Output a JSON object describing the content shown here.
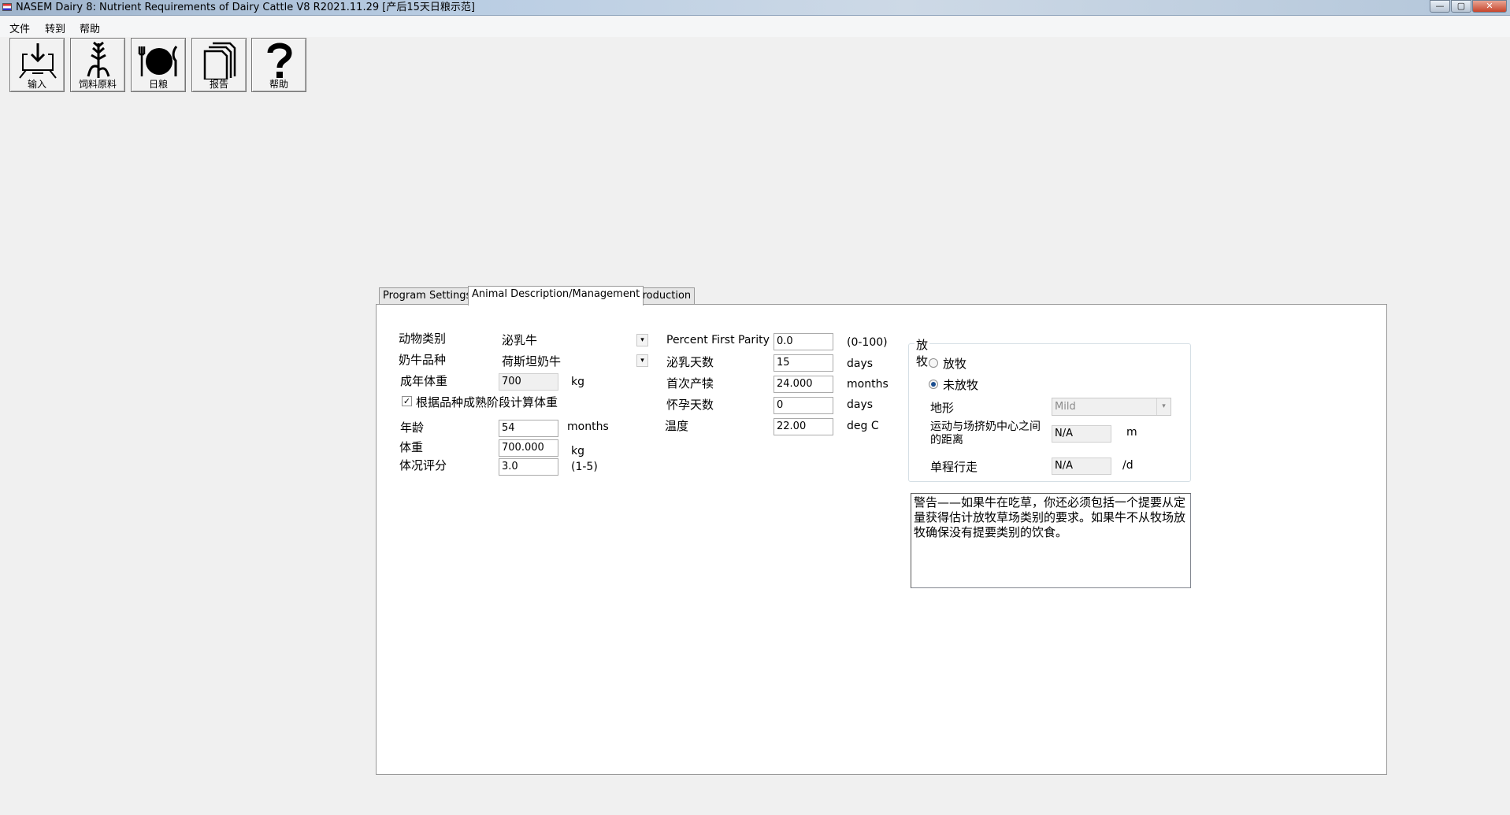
{
  "window": {
    "title": "NASEM Dairy 8: Nutrient Requirements of Dairy Cattle  V8 R2021.11.29 [产后15天日粮示范]"
  },
  "menu": {
    "items": [
      {
        "label": "文件"
      },
      {
        "label": "转到"
      },
      {
        "label": "帮助"
      }
    ]
  },
  "toolbar": {
    "buttons": [
      {
        "label": "输入",
        "icon": "input-icon"
      },
      {
        "label": "饲料原料",
        "icon": "feed-plant-icon"
      },
      {
        "label": "日粮",
        "icon": "plate-icon"
      },
      {
        "label": "报告",
        "icon": "report-icon"
      },
      {
        "label": "帮助",
        "icon": "help-icon"
      }
    ]
  },
  "tabs": [
    {
      "label": "Program Settings"
    },
    {
      "label": "Animal Description/Management",
      "active": true
    },
    {
      "label": "Production"
    }
  ],
  "animal": {
    "type_label": "动物类别",
    "type_value": "泌乳牛",
    "breed_label": "奶牛品种",
    "breed_value": "荷斯坦奶牛",
    "mature_bw_label": "成年体重",
    "mature_bw_value": "700",
    "mature_bw_unit": "kg",
    "calc_by_breed_label": "根据品种成熟阶段计算体重",
    "calc_by_breed_checked": true,
    "age_label": "年龄",
    "age_value": "54",
    "age_unit": "months",
    "bw_label": "体重",
    "bw_value": "700.000",
    "bw_unit": "kg",
    "bcs_label": "体况评分",
    "bcs_value": "3.0",
    "bcs_unit": "(1-5)"
  },
  "management": {
    "pfp_label": "Percent First Parity",
    "pfp_value": "0.0",
    "pfp_unit": "(0-100)",
    "dim_label": "泌乳天数",
    "dim_value": "15",
    "dim_unit": "days",
    "first_calving_label": "首次产犊",
    "first_calving_value": "24.000",
    "first_calving_unit": "months",
    "dpreg_label": "怀孕天数",
    "dpreg_value": "0",
    "dpreg_unit": "days",
    "temp_label": "温度",
    "temp_value": "22.00",
    "temp_unit": "deg C"
  },
  "grazing": {
    "group_label": "放牧",
    "option_graze": "放牧",
    "option_graze_selected": false,
    "option_nograze": "未放牧",
    "option_nograze_selected": true,
    "terrain_label": "地形",
    "terrain_value": "Mild",
    "distance_label": "运动与场挤奶中心之间的距离",
    "distance_value": "N/A",
    "distance_unit": "m",
    "trips_label": "单程行走",
    "trips_value": "N/A",
    "trips_unit": "/d"
  },
  "warning": {
    "text": "警告——如果牛在吃草，你还必须包括一个提要从定量获得估计放牧草场类别的要求。如果牛不从牧场放牧确保没有提要类别的饮食。"
  }
}
